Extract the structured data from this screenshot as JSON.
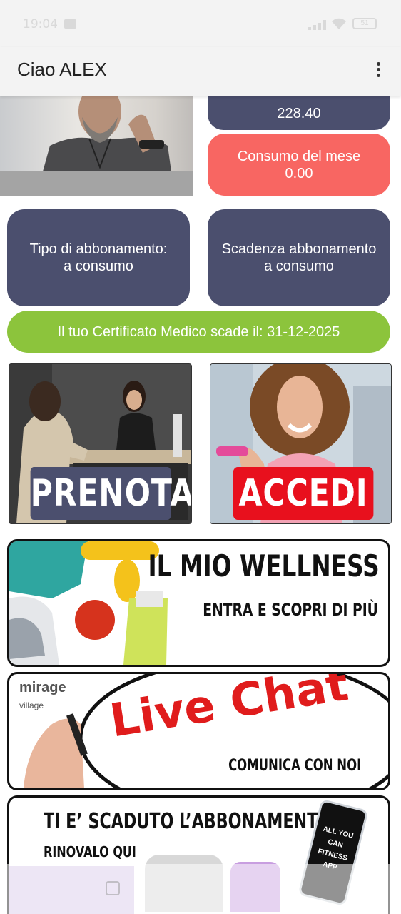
{
  "status_bar": {
    "time": "19:04",
    "battery": "51"
  },
  "app_bar": {
    "title": "Ciao ALEX"
  },
  "cards": {
    "credit_value": "228.40",
    "monthly_consumption_label": "Consumo del mese",
    "monthly_consumption_value": "0.00",
    "subscription_type_label": "Tipo di abbonamento:",
    "subscription_type_value": "a consumo",
    "subscription_expiry_label": "Scadenza abbonamento",
    "subscription_expiry_value": "a consumo",
    "medical_certificate": "Il tuo Certificato Medico scade il: 31-12-2025"
  },
  "tiles": {
    "book_label": "PRENOTA",
    "access_label": "ACCEDI"
  },
  "banners": {
    "wellness_title": "IL MIO WELLNESS",
    "wellness_subtitle": "ENTRA E SCOPRI DI PIÙ",
    "chat_brand": "mirage",
    "chat_brand_sub": "village",
    "chat_title": "Live Chat",
    "chat_subtitle": "COMUNICA CON NOI",
    "renew_title": "TI E’ SCADUTO L’ABBONAMENTO?",
    "renew_subtitle": "RINOVALO QUI",
    "renew_phone_text": "ALL YOU CAN FITNESS APP"
  },
  "colors": {
    "navy": "#4b4f6e",
    "red": "#f86662",
    "green": "#8cc43c",
    "accedi_red": "#e8101d"
  }
}
